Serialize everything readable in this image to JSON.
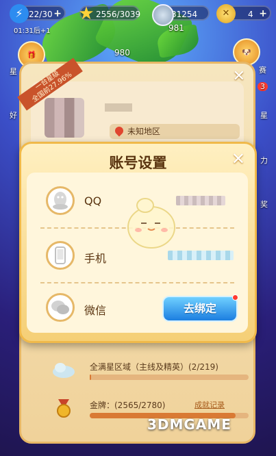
{
  "topbar": {
    "energy": "22/30",
    "timer": "01:31后+1",
    "stars": "2556/3039",
    "coins": "31254",
    "coins_sub": "981",
    "gems": "4"
  },
  "background": {
    "level_number": "980"
  },
  "side": {
    "left_top_label": "星",
    "left_mid_label": "好",
    "right_top_label": "赛",
    "right_badge": "3",
    "right_mid_label": "星",
    "right_low_label": "力",
    "right_low2_label": "奖"
  },
  "profile_card": {
    "ribbon_line1": "一台星级",
    "ribbon_line2": "全国前27.96%",
    "region": "未知地区",
    "close_label": "✕",
    "achievement1": "全满星区域（主线及精英）(2/219)",
    "achievement1_progress": 0.01,
    "achievement2": "金牌：(2565/2780)",
    "achievement2_progress": 0.92,
    "achievement_link": "成就记录"
  },
  "modal": {
    "title": "账号设置",
    "close_label": "✕",
    "rows": [
      {
        "icon": "qq-icon",
        "label": "QQ"
      },
      {
        "icon": "phone-icon",
        "label": "手机"
      },
      {
        "icon": "wechat-icon",
        "label": "微信"
      }
    ],
    "unbind_label": "去绑定"
  },
  "watermark": "3DMGAME",
  "colors": {
    "accent_blue": "#1c7ee0",
    "panel_gold": "#f5cf76",
    "title_brown": "#5a3410"
  }
}
